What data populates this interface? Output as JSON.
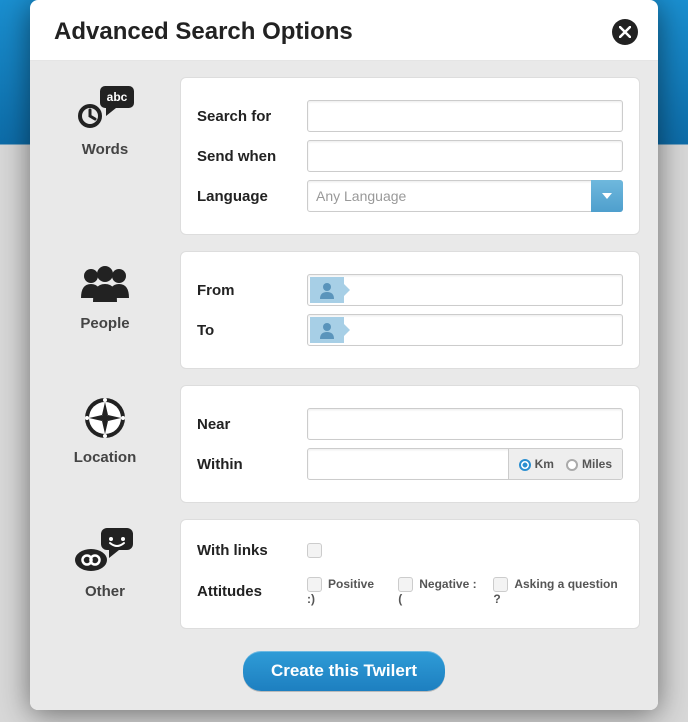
{
  "header": {
    "title": "Advanced Search Options"
  },
  "sections": {
    "words": {
      "label": "Words",
      "search_for_label": "Search for",
      "send_when_label": "Send when",
      "language_label": "Language",
      "language_placeholder": "Any Language"
    },
    "people": {
      "label": "People",
      "from_label": "From",
      "to_label": "To"
    },
    "location": {
      "label": "Location",
      "near_label": "Near",
      "within_label": "Within",
      "unit_km": "Km",
      "unit_miles": "Miles",
      "unit_selected": "Km"
    },
    "other": {
      "label": "Other",
      "with_links_label": "With links",
      "attitudes_label": "Attitudes",
      "attitude_positive": "Positive :)",
      "attitude_negative": "Negative :(",
      "attitude_question": "Asking a question ?"
    }
  },
  "footer": {
    "create_button": "Create this Twilert"
  }
}
